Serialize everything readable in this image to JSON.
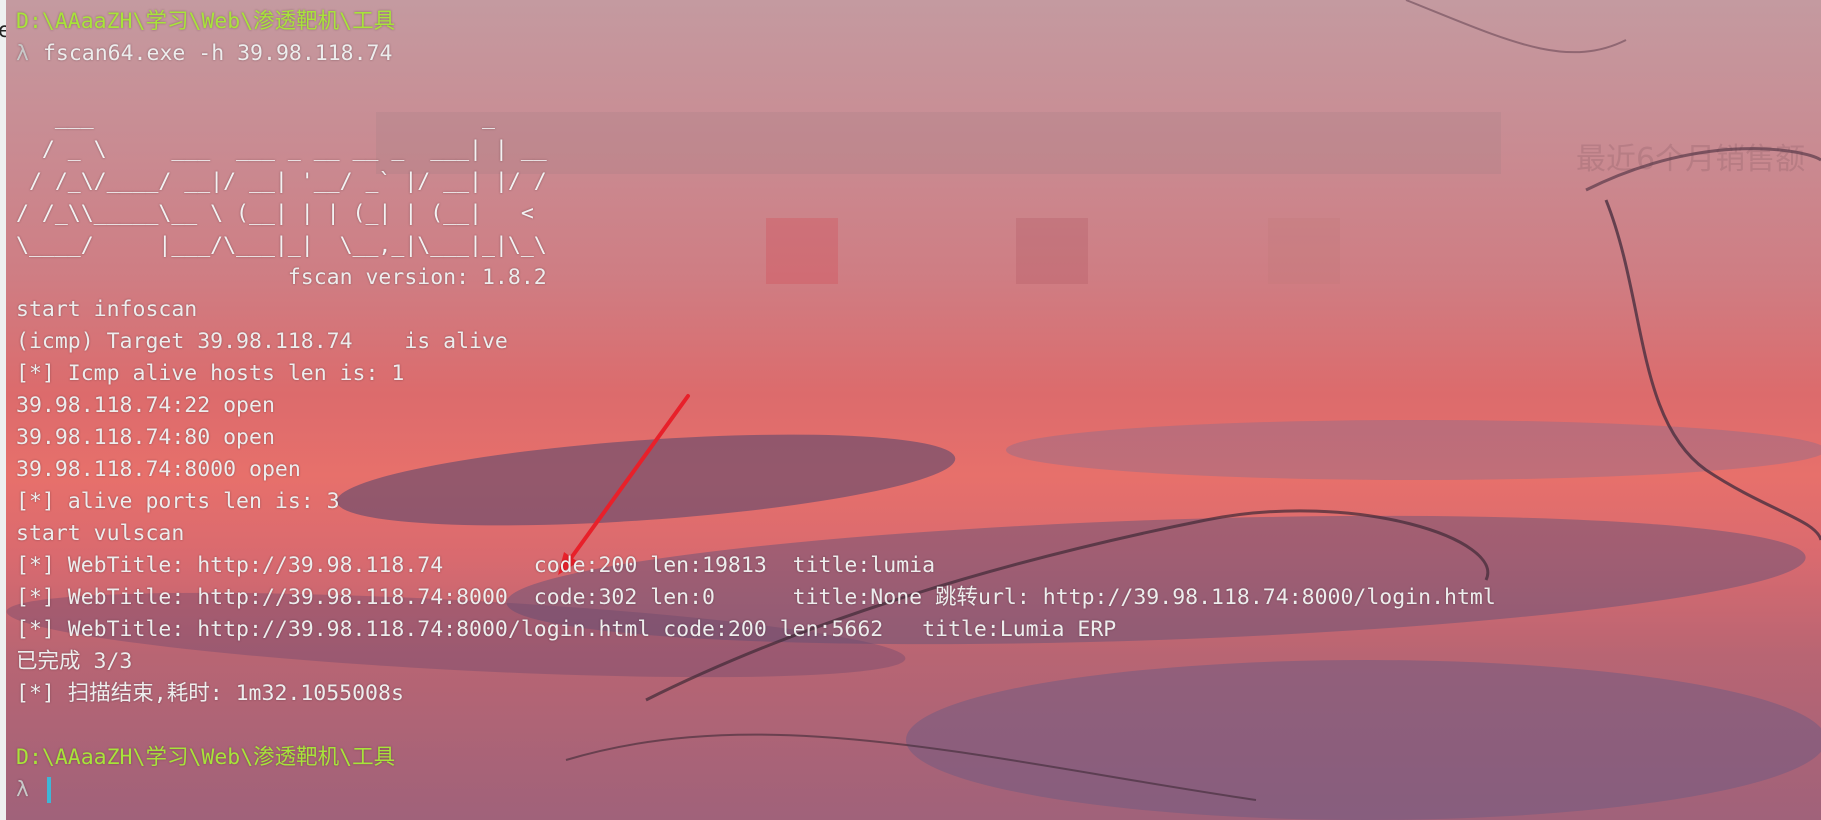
{
  "terminal": {
    "prompt_path": "D:\\AAaaZH\\学习\\Web\\渗透靶机\\工具",
    "prompt_symbol": "λ",
    "command": "fscan64.exe -h 39.98.118.74",
    "banner": "   ___                              _\n  / _ \\     ___  ___ _ __ __ _  ___| | __\n / /_\\/____/ __|/ __| '__/ _` |/ __| |/ /\n/ /_\\\\_____\\__ \\ (__| | | (_| | (__|   <\n\\____/     |___/\\___|_|  \\__,_|\\___|_|\\_\\",
    "version_line": "                     fscan version: 1.8.2",
    "output_lines": [
      "start infoscan",
      "(icmp) Target 39.98.118.74    is alive",
      "[*] Icmp alive hosts len is: 1",
      "39.98.118.74:22 open",
      "39.98.118.74:80 open",
      "39.98.118.74:8000 open",
      "[*] alive ports len is: 3",
      "start vulscan",
      "[*] WebTitle: http://39.98.118.74       code:200 len:19813  title:lumia",
      "[*] WebTitle: http://39.98.118.74:8000  code:302 len:0      title:None 跳转url: http://39.98.118.74:8000/login.html",
      "[*] WebTitle: http://39.98.118.74:8000/login.html code:200 len:5662   title:Lumia ERP",
      "已完成 3/3",
      "[*] 扫描结束,耗时: 1m32.1055008s"
    ],
    "second_prompt_path": "D:\\AAaaZH\\学习\\Web\\渗透靶机\\工具",
    "second_prompt_symbol": "λ"
  },
  "background_ghost": {
    "chart_title": "最近6个月销售额"
  },
  "colors": {
    "prompt_path": "#a8e33a",
    "output_text": "#ededed",
    "arrow": "#e8202a",
    "cursor": "#3fb6d6"
  },
  "edge_char": "e"
}
